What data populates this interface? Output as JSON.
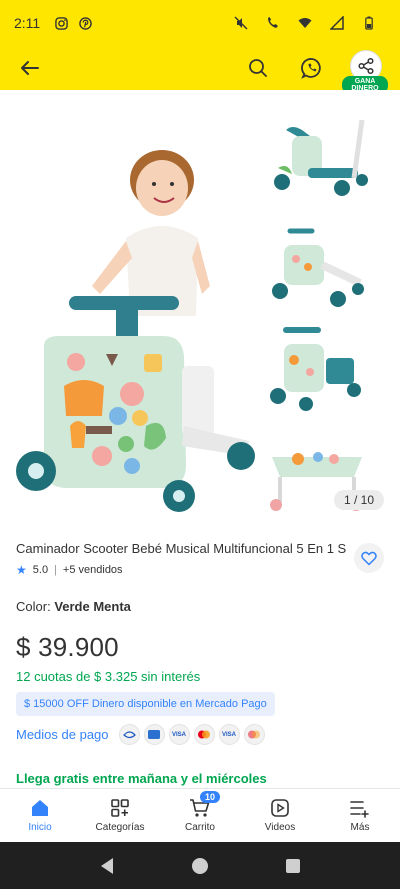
{
  "status_bar": {
    "time": "2:11"
  },
  "header": {
    "gana_badge": "GANA DINERO"
  },
  "gallery": {
    "counter": "1 / 10"
  },
  "product": {
    "title": "Caminador Scooter Bebé Musical Multifuncional 5 En 1 S",
    "rating": "5.0",
    "sold": "+5 vendidos",
    "color_label": "Color:",
    "color_value": "Verde Menta",
    "price": "$ 39.900",
    "installments": "12 cuotas de $ 3.325 sin interés",
    "promo": "$ 15000 OFF Dinero disponible en Mercado Pago",
    "payment_label": "Medios de pago",
    "payment_methods": [
      "visa",
      "amex",
      "visa",
      "mastercard",
      "visa",
      "mastercard"
    ],
    "shipping": "Llega gratis entre mañana y el miércoles"
  },
  "bottom_nav": {
    "items": [
      {
        "label": "Inicio",
        "icon": "home-icon",
        "active": true
      },
      {
        "label": "Categorías",
        "icon": "categories-icon"
      },
      {
        "label": "Carrito",
        "icon": "cart-icon",
        "badge": "10"
      },
      {
        "label": "Videos",
        "icon": "video-icon"
      },
      {
        "label": "Más",
        "icon": "menu-plus-icon"
      }
    ]
  },
  "colors": {
    "yellow": "#ffe600",
    "blue": "#3483fa",
    "green": "#00a650"
  }
}
